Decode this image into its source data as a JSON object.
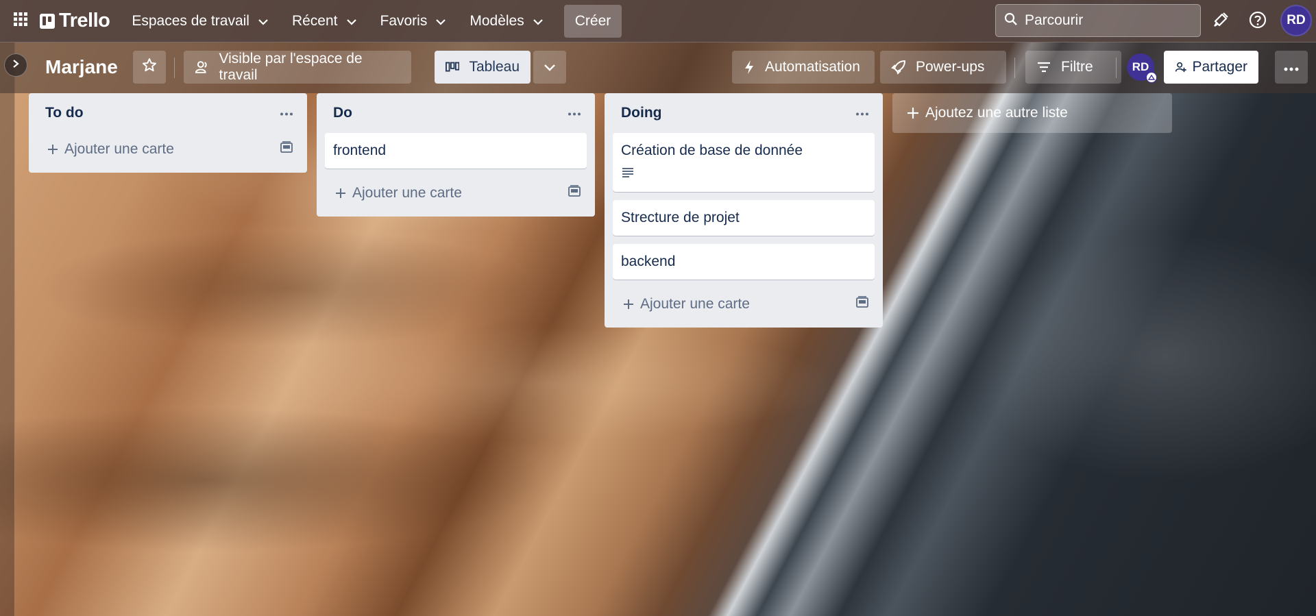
{
  "header": {
    "logo_text": "Trello",
    "nav": [
      {
        "label": "Espaces de travail"
      },
      {
        "label": "Récent"
      },
      {
        "label": "Favoris"
      },
      {
        "label": "Modèles"
      }
    ],
    "create_label": "Créer",
    "search_placeholder": "Parcourir",
    "user_initials": "RD"
  },
  "board": {
    "title": "Marjane",
    "visibility_label": "Visible par l'espace de travail",
    "view_label": "Tableau",
    "automation_label": "Automatisation",
    "powerups_label": "Power-ups",
    "filter_label": "Filtre",
    "member_initials": "RD",
    "share_label": "Partager"
  },
  "lists": [
    {
      "title": "To do",
      "cards": [],
      "add_card_label": "Ajouter une carte"
    },
    {
      "title": "Do",
      "cards": [
        {
          "title": "frontend",
          "has_description": false
        }
      ],
      "add_card_label": "Ajouter une carte"
    },
    {
      "title": "Doing",
      "cards": [
        {
          "title": "Création de base de donnée",
          "has_description": true
        },
        {
          "title": "Strecture de projet",
          "has_description": false
        },
        {
          "title": "backend",
          "has_description": false
        }
      ],
      "add_card_label": "Ajouter une carte"
    }
  ],
  "add_list_label": "Ajoutez une autre liste",
  "colors": {
    "header_bg": "#53433e",
    "list_bg": "#ebecf0",
    "avatar_bg": "#403294",
    "text_dark": "#172b4d"
  }
}
